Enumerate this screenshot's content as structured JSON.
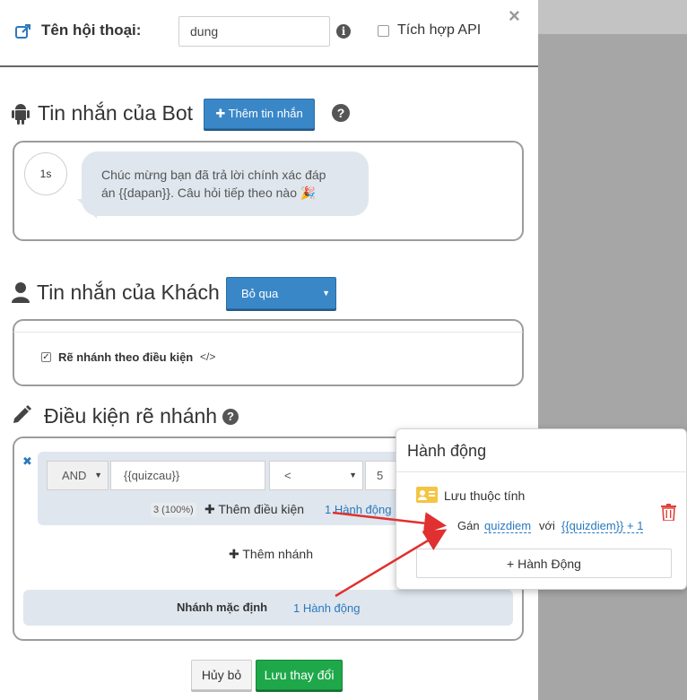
{
  "header": {
    "title_label": "Tên hội thoại:",
    "name_value": "dung",
    "api_label": "Tích hợp API",
    "close_glyph": "×"
  },
  "bot_section": {
    "title": "Tin nhắn của Bot",
    "add_button": "✚ Thêm tin nhắn",
    "delay": "1s",
    "message_line1": "Chúc mừng bạn đã trả lời chính xác đáp",
    "message_line2": "án {{dapan}}. Câu hỏi tiếp theo nào 🎉"
  },
  "guest_section": {
    "title": "Tin nhắn của Khách",
    "select_value": "Bỏ qua",
    "branch_checkbox_label": "Rẽ nhánh theo điều kiện",
    "code_glyph": "</>"
  },
  "condition_section": {
    "title": "Điều kiện rẽ nhánh",
    "operator_logic": "AND",
    "variable": "{{quizcau}}",
    "comparison": "<",
    "compare_value": "5",
    "match_badge": "3 (100%)",
    "add_condition": "✚ Thêm điều kiện",
    "action_link": "1 Hành động",
    "add_branch": "✚ Thêm nhánh",
    "default_branch_label": "Nhánh mặc định",
    "default_branch_action": "1 Hành động",
    "remove_glyph": "✖"
  },
  "footer": {
    "cancel": "Hủy bỏ",
    "save": "Lưu thay đổi"
  },
  "action_popup": {
    "title": "Hành động",
    "action_type": "Lưu thuộc tính",
    "assign_label": "Gán",
    "attribute": "quizdiem",
    "with_label": "với",
    "expression": "{{quizdiem}} + 1",
    "add_action": "+ Hành Động"
  },
  "colors": {
    "primary_blue": "#3a87c8",
    "save_green": "#1fa84a",
    "delete_red": "#e0403a",
    "arrow_red": "#e03030",
    "bubble_bg": "#dfe6ee"
  }
}
